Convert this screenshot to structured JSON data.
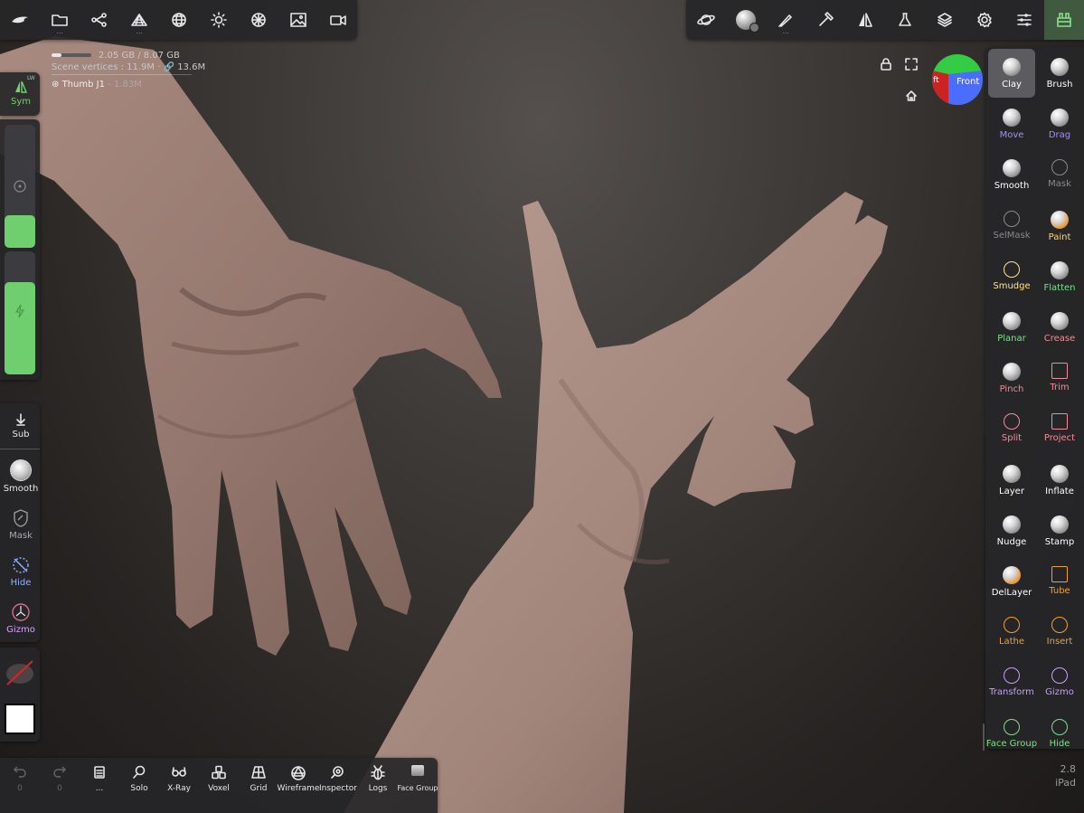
{
  "top_left_toolbar": {
    "icons": [
      "nomad-logo-icon",
      "folder-icon",
      "scene-graph-icon",
      "topology-icon",
      "sphere-wireframe-icon",
      "sun-icon",
      "material-icon",
      "image-icon",
      "video-camera-icon"
    ]
  },
  "top_right_toolbar": {
    "icons": [
      "planet-icon",
      "clay-sphere-icon",
      "brush-stroke-icon",
      "hammer-icon",
      "symmetry-icon",
      "flask-icon",
      "layers-icon",
      "gear-icon",
      "sliders-icon",
      "tools-panel-icon"
    ]
  },
  "stats": {
    "memory": "2.05 GB / 8.07 GB",
    "memory_fraction": 0.25,
    "vertices": "Scene vertices : 11.9M · 🔗 13.6M",
    "object_name": "Thumb J1",
    "object_suffix": " - 1.83M"
  },
  "viewport_controls": {
    "cube_left": "ft",
    "cube_front": "Front"
  },
  "left_panel": {
    "sym_label": "Sym",
    "sym_badge": "LW",
    "sub_label": "Sub",
    "smooth_label": "Smooth",
    "mask_label": "Mask",
    "hide_label": "Hide",
    "gizmo_label": "Gizmo"
  },
  "tools": [
    {
      "label": "Clay",
      "color": "#ffffff"
    },
    {
      "label": "Brush",
      "color": "#ffffff"
    },
    {
      "label": "Move",
      "color": "#a58cff"
    },
    {
      "label": "Drag",
      "color": "#a58cff"
    },
    {
      "label": "Smooth",
      "color": "#ffffff"
    },
    {
      "label": "Mask",
      "color": "#8a8a8a"
    },
    {
      "label": "SelMask",
      "color": "#8a8a8a"
    },
    {
      "label": "Paint",
      "color": "#ffd37a"
    },
    {
      "label": "Smudge",
      "color": "#ffe38a"
    },
    {
      "label": "Flatten",
      "color": "#7ee08a"
    },
    {
      "label": "Planar",
      "color": "#7ee08a"
    },
    {
      "label": "Crease",
      "color": "#f28c9a"
    },
    {
      "label": "Pinch",
      "color": "#f28c9a"
    },
    {
      "label": "Trim",
      "color": "#f28c9a"
    },
    {
      "label": "Split",
      "color": "#f28c9a"
    },
    {
      "label": "Project",
      "color": "#f28c9a"
    },
    {
      "label": "Layer",
      "color": "#ffffff"
    },
    {
      "label": "Inflate",
      "color": "#ffffff"
    },
    {
      "label": "Nudge",
      "color": "#ffffff"
    },
    {
      "label": "Stamp",
      "color": "#ffffff"
    },
    {
      "label": "DelLayer",
      "color": "#ffffff"
    },
    {
      "label": "Tube",
      "color": "#f0a030"
    },
    {
      "label": "Lathe",
      "color": "#f0a030"
    },
    {
      "label": "Insert",
      "color": "#f0a030"
    },
    {
      "label": "Transform",
      "color": "#c89cff"
    },
    {
      "label": "Gizmo",
      "color": "#c89cff"
    },
    {
      "label": "Face Group",
      "color": "#7ee08a"
    },
    {
      "label": "Hide",
      "color": "#7ee08a"
    }
  ],
  "bottom_bar": {
    "undo_count": "0",
    "redo_count": "0",
    "more_label": "...",
    "solo_label": "Solo",
    "xray_label": "X-Ray",
    "voxel_label": "Voxel",
    "grid_label": "Grid",
    "wireframe_label": "Wireframe",
    "inspector_label": "Inspector",
    "logs_label": "Logs",
    "facegroup_label": "Face Group"
  },
  "version": {
    "number": "2.8",
    "device": "iPad"
  }
}
